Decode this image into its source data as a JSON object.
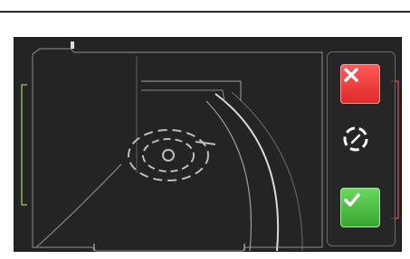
{
  "colors": {
    "background": "#242424",
    "frame_line": "#7a7a7a",
    "guide_line": "#cfcfcf",
    "cancel": "#ee3b3b",
    "confirm": "#4fbf46",
    "left_bracket": "#8ab35a",
    "right_bracket": "#c24444"
  },
  "icons": {
    "cancel": "close-icon",
    "reset": "recenter-icon",
    "confirm": "check-icon"
  }
}
